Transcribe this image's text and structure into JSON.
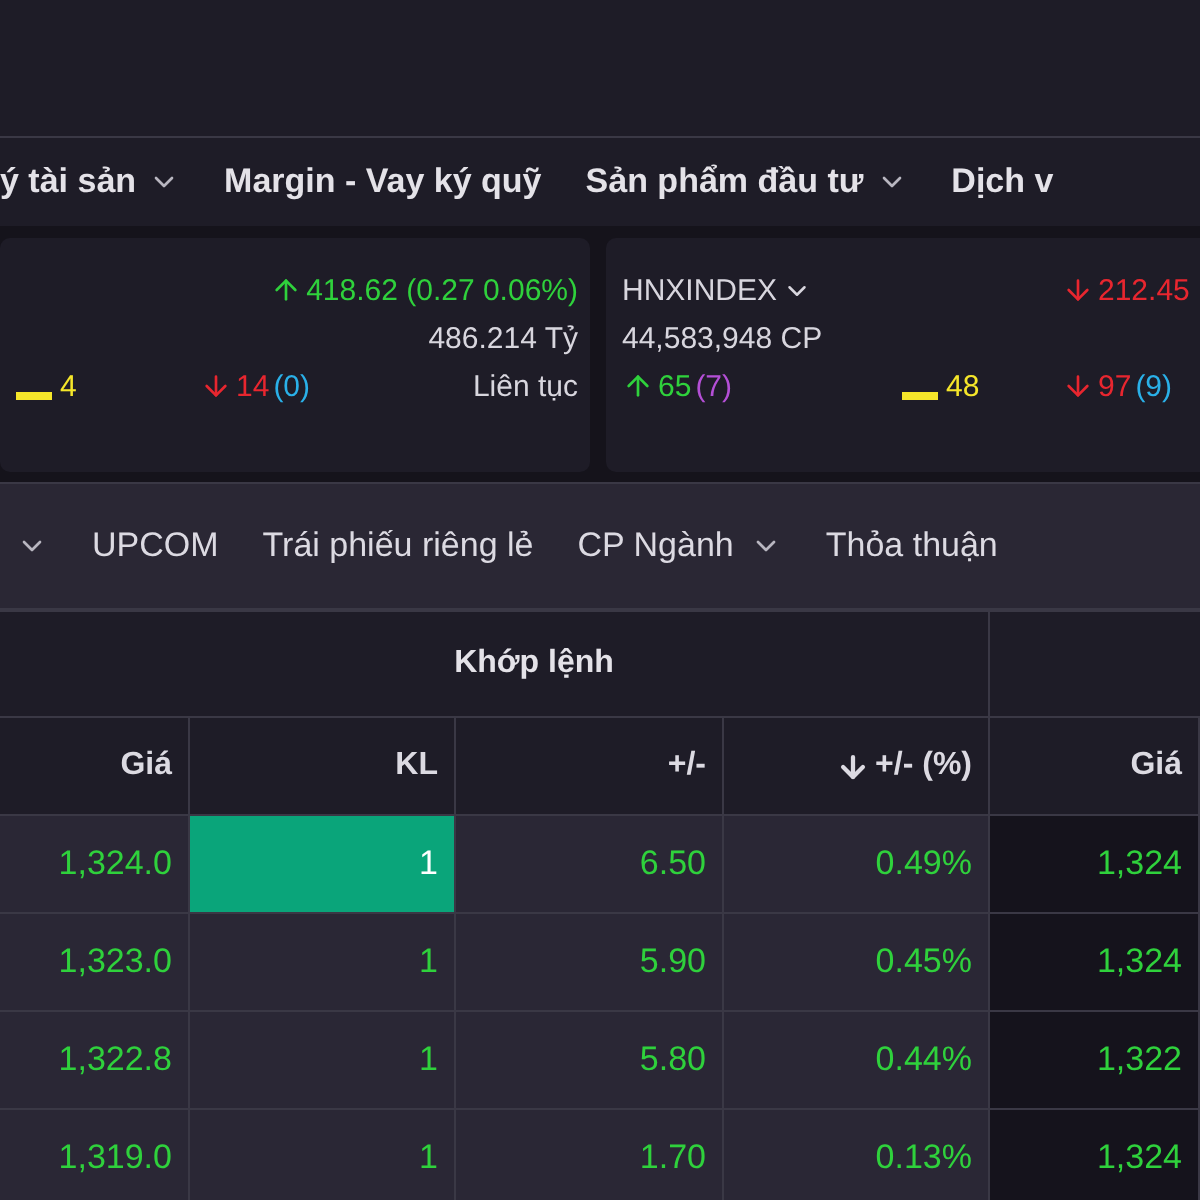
{
  "nav": [
    {
      "label": "ý tài sản",
      "dropdown": true
    },
    {
      "label": "Margin - Vay ký quỹ",
      "dropdown": false
    },
    {
      "label": "Sản phẩm đầu tư",
      "dropdown": true
    },
    {
      "label": "Dịch v",
      "dropdown": false
    }
  ],
  "indices": [
    {
      "change": {
        "kind": "up",
        "text": "418.62 (0.27 0.06%)"
      },
      "value": "486.214 Tỷ",
      "session": "Liên tục",
      "unchanged": "4",
      "declines": {
        "count": "14",
        "floor": "(0)"
      }
    },
    {
      "name": "HNXINDEX",
      "dropdown": true,
      "change": {
        "kind": "down",
        "text": "212.45"
      },
      "volume": "44,583,948 CP",
      "advances": {
        "count": "65",
        "ceiling": "(7)"
      },
      "unchanged": "48",
      "declines": {
        "count": "97",
        "floor": "(9)"
      }
    }
  ],
  "tabs": [
    {
      "dropdown": true,
      "selected": false
    },
    {
      "label": "UPCOM",
      "dropdown": false,
      "selected": false
    },
    {
      "label": "Trái phiếu riêng lẻ",
      "dropdown": false,
      "selected": false
    },
    {
      "label": "CP Ngành",
      "dropdown": true,
      "selected": false
    },
    {
      "label": "Thỏa thuận",
      "dropdown": false,
      "selected": false
    }
  ],
  "table": {
    "group": "Khớp lệnh",
    "columns": [
      {
        "label": "Giá",
        "sorted": false
      },
      {
        "label": "KL",
        "sorted": false
      },
      {
        "label": "+/-",
        "sorted": false
      },
      {
        "label": "+/- (%)",
        "sorted": true
      },
      {
        "label": "Giá",
        "sorted": false
      }
    ],
    "rows": [
      {
        "cells": [
          "1,324.0",
          "1",
          "6.50",
          "0.49%",
          "1,324"
        ],
        "flash": true
      },
      {
        "cells": [
          "1,323.0",
          "1",
          "5.90",
          "0.45%",
          "1,324"
        ],
        "flash": false
      },
      {
        "cells": [
          "1,322.8",
          "1",
          "5.80",
          "0.44%",
          "1,322"
        ],
        "flash": false
      },
      {
        "cells": [
          "1,319.0",
          "1",
          "1.70",
          "0.13%",
          "1,324"
        ],
        "flash": false
      }
    ]
  }
}
